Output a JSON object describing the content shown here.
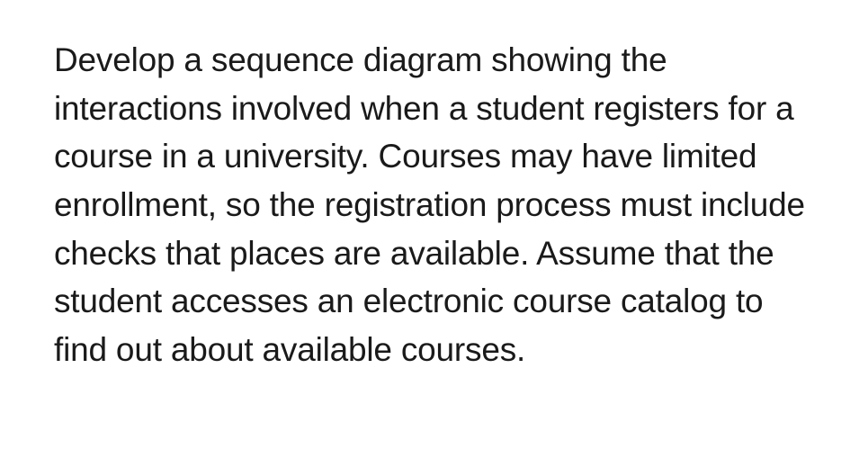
{
  "paragraph": "Develop a sequence diagram showing the interactions involved when a student registers for a course in a university. Courses may have limited enrollment, so the registration process must include checks that places are available. Assume that the student accesses an electronic course catalog to find out about available courses."
}
